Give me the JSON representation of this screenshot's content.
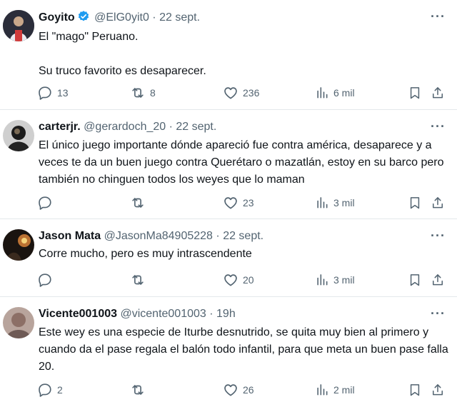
{
  "tweets": [
    {
      "name": "Goyito",
      "handle": "@ElG0yit0",
      "sep": "·",
      "time": "22 sept.",
      "text": "El \"mago\" Peruano.\n\nSu truco favorito es desaparecer.",
      "replies": "13",
      "retweets": "8",
      "likes": "236",
      "views": "6 mil"
    },
    {
      "name": "carterjr.",
      "handle": "@gerardoch_20",
      "sep": "·",
      "time": "22 sept.",
      "text": "El único juego importante dónde apareció fue contra américa, desaparece y a veces te da un buen juego contra Querétaro o mazatlán, estoy en su barco pero también no chinguen todos los weyes que lo maman",
      "replies": "",
      "retweets": "",
      "likes": "23",
      "views": "3 mil"
    },
    {
      "name": "Jason Mata",
      "handle": "@JasonMa84905228",
      "sep": "·",
      "time": "22 sept.",
      "text": "Corre mucho, pero es muy intrascendente",
      "replies": "",
      "retweets": "",
      "likes": "20",
      "views": "3 mil"
    },
    {
      "name": "Vicente001003",
      "handle": "@vicente001003",
      "sep": "·",
      "time": "19h",
      "text": "Este wey es una especie de Iturbe desnutrido, se quita muy bien al primero y cuando da el pase regala el balón todo infantil, para que meta un buen pase falla 20.",
      "replies": "2",
      "retweets": "",
      "likes": "26",
      "views": "2 mil"
    }
  ],
  "more_label": "···",
  "colors": {
    "verified": "#1d9bf0",
    "muted": "#536471",
    "divider": "#e4e8eb"
  },
  "icons": [
    "reply-icon",
    "retweet-icon",
    "like-icon",
    "views-icon",
    "bookmark-icon",
    "share-icon",
    "more-icon",
    "verified-badge-icon"
  ]
}
